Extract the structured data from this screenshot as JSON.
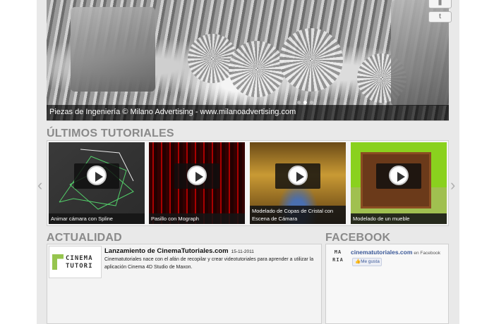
{
  "hero": {
    "caption": "Piezas de Ingeniería © Milano Advertising - www.milanoadvertising.com",
    "slides": [
      false,
      true,
      false
    ]
  },
  "social": [
    "youtube-icon",
    "twitter-icon"
  ],
  "tutorials": {
    "title": "ÚLTIMOS TUTORIALES",
    "items": [
      {
        "title": "Animar cámara con Spline",
        "thumb": "green-wireframe"
      },
      {
        "title": "Pasillo con Mograph",
        "thumb": "red-corridor"
      },
      {
        "title": "Modelado de Copas de Cristal con Escena de Cámara",
        "thumb": "gold-room"
      },
      {
        "title": "Modelado de un mueble",
        "thumb": "wood-cabinet"
      }
    ]
  },
  "news": {
    "title": "ACTUALIDAD",
    "logo_text": "CINEMA TUTORI",
    "headline": "Lanzamiento de CinemaTutoriales.com",
    "date": "15-11-2011",
    "body": "Cinematutoriales nace con el afán de recopilar y crear videotutoriales para aprender a utilizar la aplicación Cinema 4D Studio de Maxon."
  },
  "facebook": {
    "title": "FACEBOOK",
    "logo_text": "MA RIA",
    "page_name": "cinematutoriales.com",
    "suffix": "en Facebook",
    "like_label": "Me gusta"
  }
}
